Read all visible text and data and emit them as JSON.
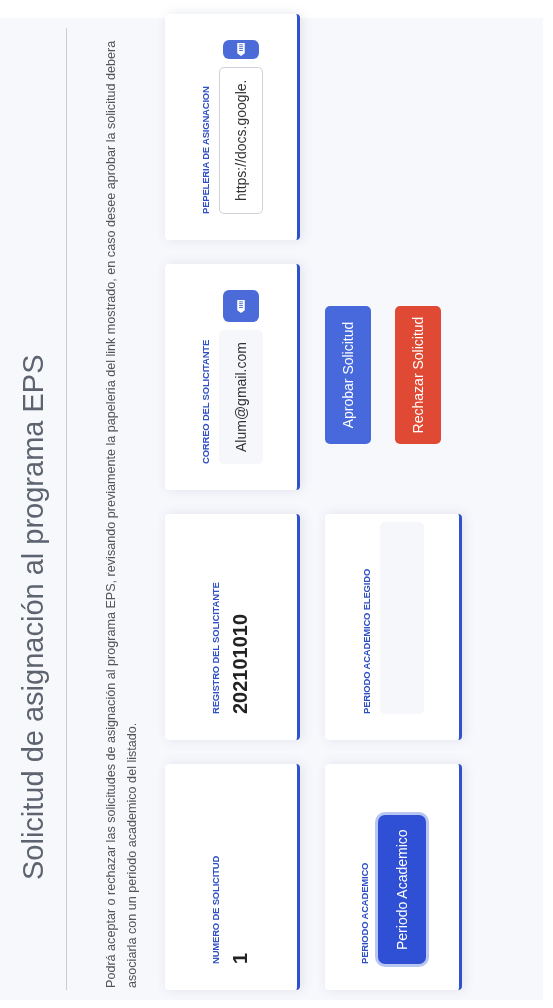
{
  "title": "Solicitud de asignación al programa EPS",
  "description": "Podrá aceptar o rechazar las solicitudes de asignación al programa EPS, revisando previamente la papeleria del link mostrado, en caso desee aprobar la solicitud debera asociarla con un periodo academico del listado.",
  "info_cards": [
    {
      "kind": "number",
      "label": "NUMERO DE SOLICITUD",
      "value": "1"
    },
    {
      "kind": "number",
      "label": "REGISTRO DEL SOLICITANTE",
      "value": "202101010"
    },
    {
      "kind": "field",
      "label": "CORREO DEL SOLICITANTE",
      "value": "Alum@gmail.com",
      "bordered": false
    },
    {
      "kind": "field",
      "label": "PEPELERIA DE ASIGNACION",
      "value": "https://docs.google.",
      "bordered": true
    }
  ],
  "period_cards": [
    {
      "kind": "select-button",
      "label": "PERIODO ACADEMICO",
      "value": "Periodo Academico",
      "focused": true
    },
    {
      "kind": "empty-field",
      "label": "PERIODO ACADEMICO ELEGIDO"
    }
  ],
  "actions": [
    {
      "kind": "approve",
      "label": "Aprobar Solicitud"
    },
    {
      "kind": "reject",
      "label": "Rechazar Solicitud"
    }
  ]
}
